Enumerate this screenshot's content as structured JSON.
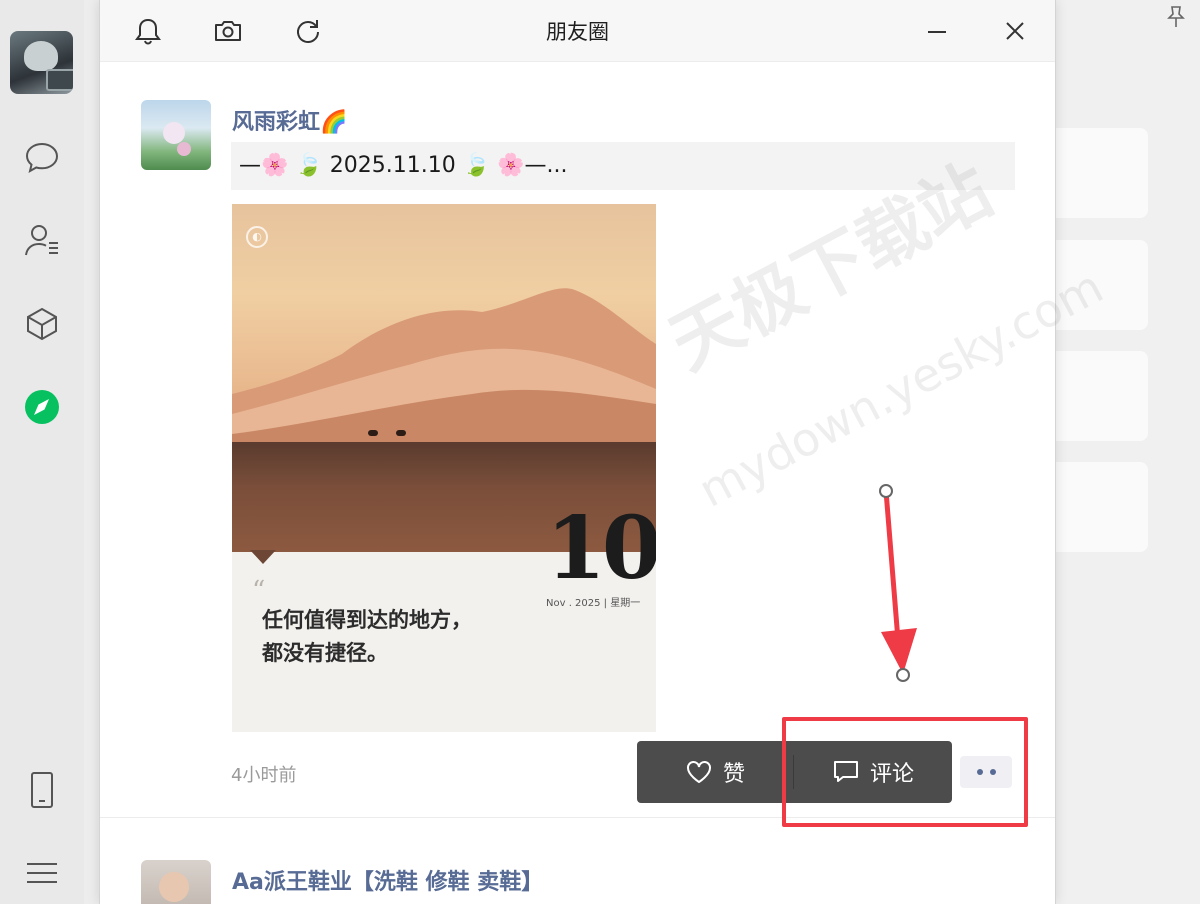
{
  "window": {
    "title": "朋友圈",
    "icons": [
      "bell-icon",
      "camera-icon",
      "refresh-icon",
      "minimize-icon",
      "close-icon"
    ]
  },
  "sidebar": {
    "items": [
      "chat-icon",
      "contacts-icon",
      "cube-icon",
      "discover-icon",
      "phone-icon",
      "menu-icon"
    ],
    "active_color": "#07c160"
  },
  "posts": [
    {
      "author": "风雨彩虹🌈",
      "text": "—🌸 🍃 2025.11.10 🍃 🌸—...",
      "image": {
        "day": "10",
        "date_line": "Nov . 2025 | 星期一",
        "quote_line1": "任何值得到达的地方，",
        "quote_line2": "都没有捷径。"
      },
      "time": "4小时前"
    },
    {
      "author": "Aa派王鞋业【洗鞋 修鞋 卖鞋】"
    }
  ],
  "actions": {
    "like_label": "赞",
    "comment_label": "评论"
  },
  "watermark": {
    "line1": "天极下载站",
    "line2": "mydown.yesky.com"
  },
  "colors": {
    "author_link": "#576b95",
    "annotation": "#ee3b45",
    "action_bar": "#4c4c4c"
  }
}
